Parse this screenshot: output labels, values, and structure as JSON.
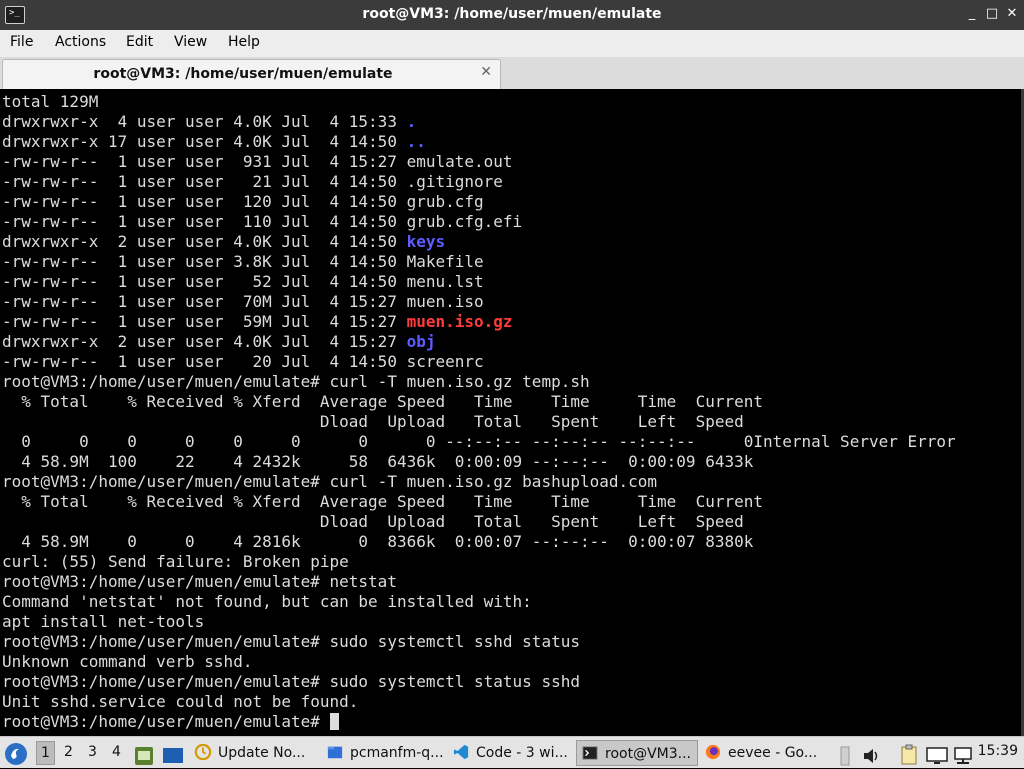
{
  "window": {
    "title": "root@VM3: /home/user/muen/emulate",
    "controls": {
      "minimize": "_",
      "maximize": "□",
      "close": "✕"
    }
  },
  "menu": [
    "File",
    "Actions",
    "Edit",
    "View",
    "Help"
  ],
  "tab": {
    "label": "root@VM3: /home/user/muen/emulate",
    "close": "✕"
  },
  "terminal": {
    "lines": [
      {
        "t": "total 129M"
      },
      {
        "t": "drwxrwxr-x  4 user user 4.0K Jul  4 15:33 ",
        "s": ".",
        "c": "dir"
      },
      {
        "t": "drwxrwxr-x 17 user user 4.0K Jul  4 14:50 ",
        "s": "..",
        "c": "dir"
      },
      {
        "t": "-rw-rw-r--  1 user user  931 Jul  4 15:27 emulate.out"
      },
      {
        "t": "-rw-rw-r--  1 user user   21 Jul  4 14:50 .gitignore"
      },
      {
        "t": "-rw-rw-r--  1 user user  120 Jul  4 14:50 grub.cfg"
      },
      {
        "t": "-rw-rw-r--  1 user user  110 Jul  4 14:50 grub.cfg.efi"
      },
      {
        "t": "drwxrwxr-x  2 user user 4.0K Jul  4 14:50 ",
        "s": "keys",
        "c": "dir"
      },
      {
        "t": "-rw-rw-r--  1 user user 3.8K Jul  4 14:50 Makefile"
      },
      {
        "t": "-rw-rw-r--  1 user user   52 Jul  4 14:50 menu.lst"
      },
      {
        "t": "-rw-rw-r--  1 user user  70M Jul  4 15:27 muen.iso"
      },
      {
        "t": "-rw-rw-r--  1 user user  59M Jul  4 15:27 ",
        "s": "muen.iso.gz",
        "c": "arc"
      },
      {
        "t": "drwxrwxr-x  2 user user 4.0K Jul  4 15:27 ",
        "s": "obj",
        "c": "dir"
      },
      {
        "t": "-rw-rw-r--  1 user user   20 Jul  4 14:50 screenrc"
      },
      {
        "t": "root@VM3:/home/user/muen/emulate# curl -T muen.iso.gz temp.sh"
      },
      {
        "t": "  % Total    % Received % Xferd  Average Speed   Time    Time     Time  Current"
      },
      {
        "t": "                                 Dload  Upload   Total   Spent    Left  Speed"
      },
      {
        "t": "  0     0    0     0    0     0      0      0 --:--:-- --:--:-- --:--:--     0Internal Server Error"
      },
      {
        "t": "  4 58.9M  100    22    4 2432k     58  6436k  0:00:09 --:--:--  0:00:09 6433k"
      },
      {
        "t": "root@VM3:/home/user/muen/emulate# curl -T muen.iso.gz bashupload.com"
      },
      {
        "t": "  % Total    % Received % Xferd  Average Speed   Time    Time     Time  Current"
      },
      {
        "t": "                                 Dload  Upload   Total   Spent    Left  Speed"
      },
      {
        "t": "  4 58.9M    0     0    4 2816k      0  8366k  0:00:07 --:--:--  0:00:07 8380k"
      },
      {
        "t": "curl: (55) Send failure: Broken pipe"
      },
      {
        "t": "root@VM3:/home/user/muen/emulate# netstat"
      },
      {
        "t": "Command 'netstat' not found, but can be installed with:"
      },
      {
        "t": "apt install net-tools"
      },
      {
        "t": "root@VM3:/home/user/muen/emulate# sudo systemctl sshd status"
      },
      {
        "t": "Unknown command verb sshd."
      },
      {
        "t": "root@VM3:/home/user/muen/emulate# sudo systemctl status sshd"
      },
      {
        "t": "Unit sshd.service could not be found."
      },
      {
        "t": "root@VM3:/home/user/muen/emulate# ",
        "cursor": true
      }
    ]
  },
  "taskbar": {
    "workspaces": [
      "1",
      "2",
      "3",
      "4"
    ],
    "active_workspace": "1",
    "tasks": [
      {
        "label": "Update No...",
        "icon": "update-icon"
      },
      {
        "label": "pcmanfm-q...",
        "icon": "folder-icon"
      },
      {
        "label": "Code - 3 wi...",
        "icon": "vscode-icon"
      },
      {
        "label": "root@VM3...",
        "icon": "terminal-icon"
      },
      {
        "label": "eevee - Go...",
        "icon": "firefox-icon"
      }
    ],
    "clock": "15:39"
  }
}
